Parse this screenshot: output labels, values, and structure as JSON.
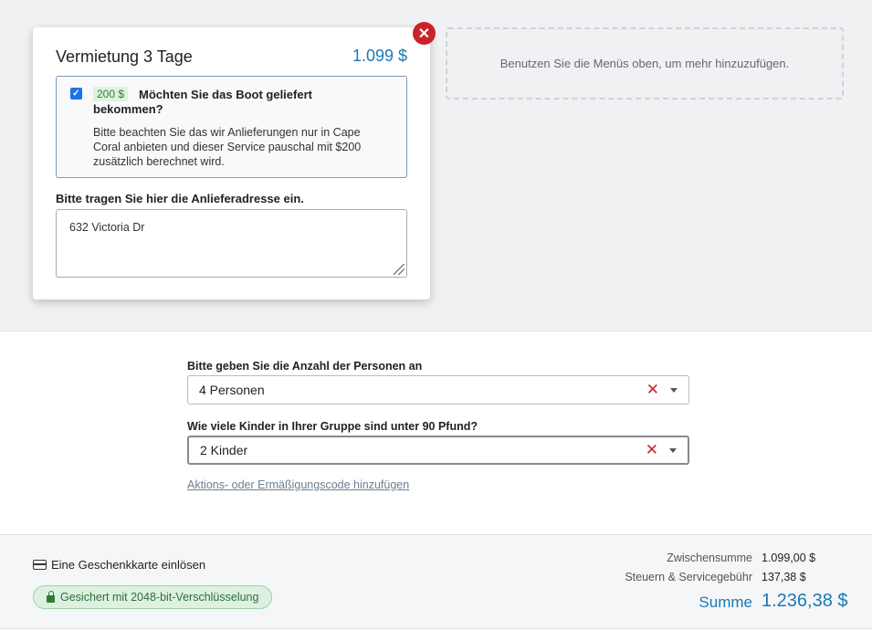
{
  "rental": {
    "title": "Vermietung 3 Tage",
    "price": "1.099 $",
    "delivery_option": {
      "checked": true,
      "badge": "200 $",
      "question": "Möchten Sie das Boot geliefert bekommen?",
      "note": "Bitte beachten Sie das wir Anlieferungen nur in Cape Coral anbieten und dieser Service pauschal mit $200 zusätzlich berechnet wird."
    },
    "address_label": "Bitte tragen Sie hier die Anlieferadresse ein.",
    "address_value": "632 Victoria Dr"
  },
  "hint_text": "Benutzen Sie die Menüs oben, um mehr hinzuzufügen.",
  "persons": {
    "label": "Bitte geben Sie die Anzahl der Personen an",
    "value": "4 Personen"
  },
  "children": {
    "label": "Wie viele Kinder in Ihrer Gruppe sind unter 90 Pfund?",
    "value": "2 Kinder"
  },
  "promo_link": "Aktions- oder Ermäßigungscode hinzufügen",
  "footer": {
    "gift_card": "Eine Geschenkkarte einlösen",
    "secure": "Gesichert mit 2048-bit-Verschlüsselung",
    "subtotal_label": "Zwischensumme",
    "subtotal_value": "1.099,00 $",
    "tax_label": "Steuern & Servicegebühr",
    "tax_value": "137,38 $",
    "total_label": "Summe",
    "total_value": "1.236,38 $"
  },
  "colors": {
    "accent": "#1b78b4",
    "close": "#c8222c",
    "secure_bg": "#ddf1e0"
  }
}
